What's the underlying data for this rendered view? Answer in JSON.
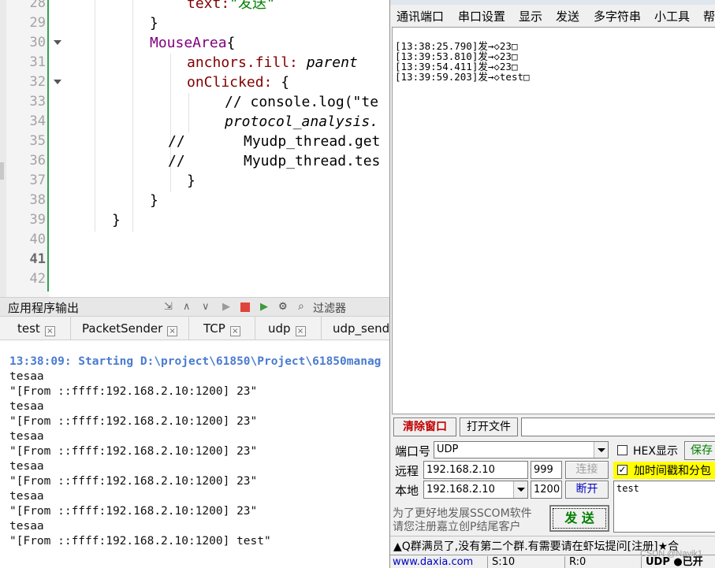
{
  "editor": {
    "lines": [
      {
        "num": "28",
        "code": "text:\"发送\""
      },
      {
        "num": "29",
        "code": "}"
      },
      {
        "num": "30",
        "code": "MouseArea{"
      },
      {
        "num": "31",
        "code": "anchors.fill: parent"
      },
      {
        "num": "32",
        "code": "onClicked: {"
      },
      {
        "num": "33",
        "code": "// console.log(\"te"
      },
      {
        "num": "34",
        "code": "protocol_analysis."
      },
      {
        "num": "35",
        "code": "//      Myudp_thread.get"
      },
      {
        "num": "36",
        "code": "//      Myudp_thread.tes"
      },
      {
        "num": "37",
        "code": "}"
      },
      {
        "num": "38",
        "code": "}"
      },
      {
        "num": "39",
        "code": "}"
      },
      {
        "num": "40",
        "code": ""
      },
      {
        "num": "41",
        "code": ""
      },
      {
        "num": "42",
        "code": ""
      }
    ],
    "tokens": {
      "text_prop": "text:",
      "text_val": "\"发送\"",
      "close_brace": "}",
      "mousearea": "MouseArea",
      "open_brace": "{",
      "anchors_prop": "anchors.fill:",
      "parent": " parent",
      "onclicked_prop": "onClicked:",
      "open_brace_sp": " {",
      "console_comment": "// console.log(\"te",
      "protocol": "protocol_analysis.",
      "comment_slash": "//",
      "get_call": "Myudp_thread.get",
      "tes_call": "Myudp_thread.tes"
    }
  },
  "output_panel": {
    "title": "应用程序输出",
    "filter_placeholder": "过滤器",
    "tabs": [
      "test",
      "PacketSender",
      "TCP",
      "udp",
      "udp_send"
    ],
    "start_line": "13:38:09: Starting D:\\project\\61850\\Project\\61850manag",
    "lines": [
      "tesaa",
      "\"[From ::ffff:192.168.2.10:1200] 23\"",
      "tesaa",
      "\"[From ::ffff:192.168.2.10:1200] 23\"",
      "tesaa",
      "\"[From ::ffff:192.168.2.10:1200] 23\"",
      "tesaa",
      "\"[From ::ffff:192.168.2.10:1200] 23\"",
      "tesaa",
      "\"[From ::ffff:192.168.2.10:1200] 23\"",
      "tesaa",
      "\"[From ::ffff:192.168.2.10:1200] test\""
    ]
  },
  "sscom": {
    "menu": [
      "通讯端口",
      "串口设置",
      "显示",
      "发送",
      "多字符串",
      "小工具",
      "帮"
    ],
    "receive_lines": [
      "[13:38:25.790]发→◇23□",
      "[13:39:53.810]发→◇23□",
      "[13:39:54.411]发→◇23□",
      "[13:39:59.203]发→◇test□"
    ],
    "clear_button": "清除窗口",
    "open_file_button": "打开文件",
    "port_label": "端口号",
    "port_value": "UDP",
    "hex_label": "HEX显示",
    "save_button": "保存",
    "remote_label": "远程",
    "remote_ip": "192.168.2.10",
    "remote_port": "999",
    "connect_button": "连接",
    "timestamp_label": "加时间戳和分包",
    "local_label": "本地",
    "local_ip": "192.168.2.10",
    "local_port": "1200",
    "disconnect_button": "断开",
    "promo_line1": "为了更好地发展SSCOM软件",
    "promo_line2": "请您注册嘉立创P结尾客户",
    "send_button": "发 送",
    "send_text": "test",
    "status_message": "▲Q群满员了,没有第二个群.有需要请在虾坛提问[注册]★合",
    "bottom": [
      "www.daxia.com",
      "S:10",
      "R:0",
      "UDP  ●已开"
    ]
  },
  "colors": {
    "keyword_type": "#800080",
    "property": "#800000",
    "string": "#008000",
    "comment": "#008000",
    "start_line": "#4a7bd0",
    "clear_button_text": "#c00000",
    "highlight_yellow": "#ffff00",
    "save_green": "#008000",
    "link_blue": "#0000c0"
  },
  "watermark": "CSDN @Nayik1"
}
